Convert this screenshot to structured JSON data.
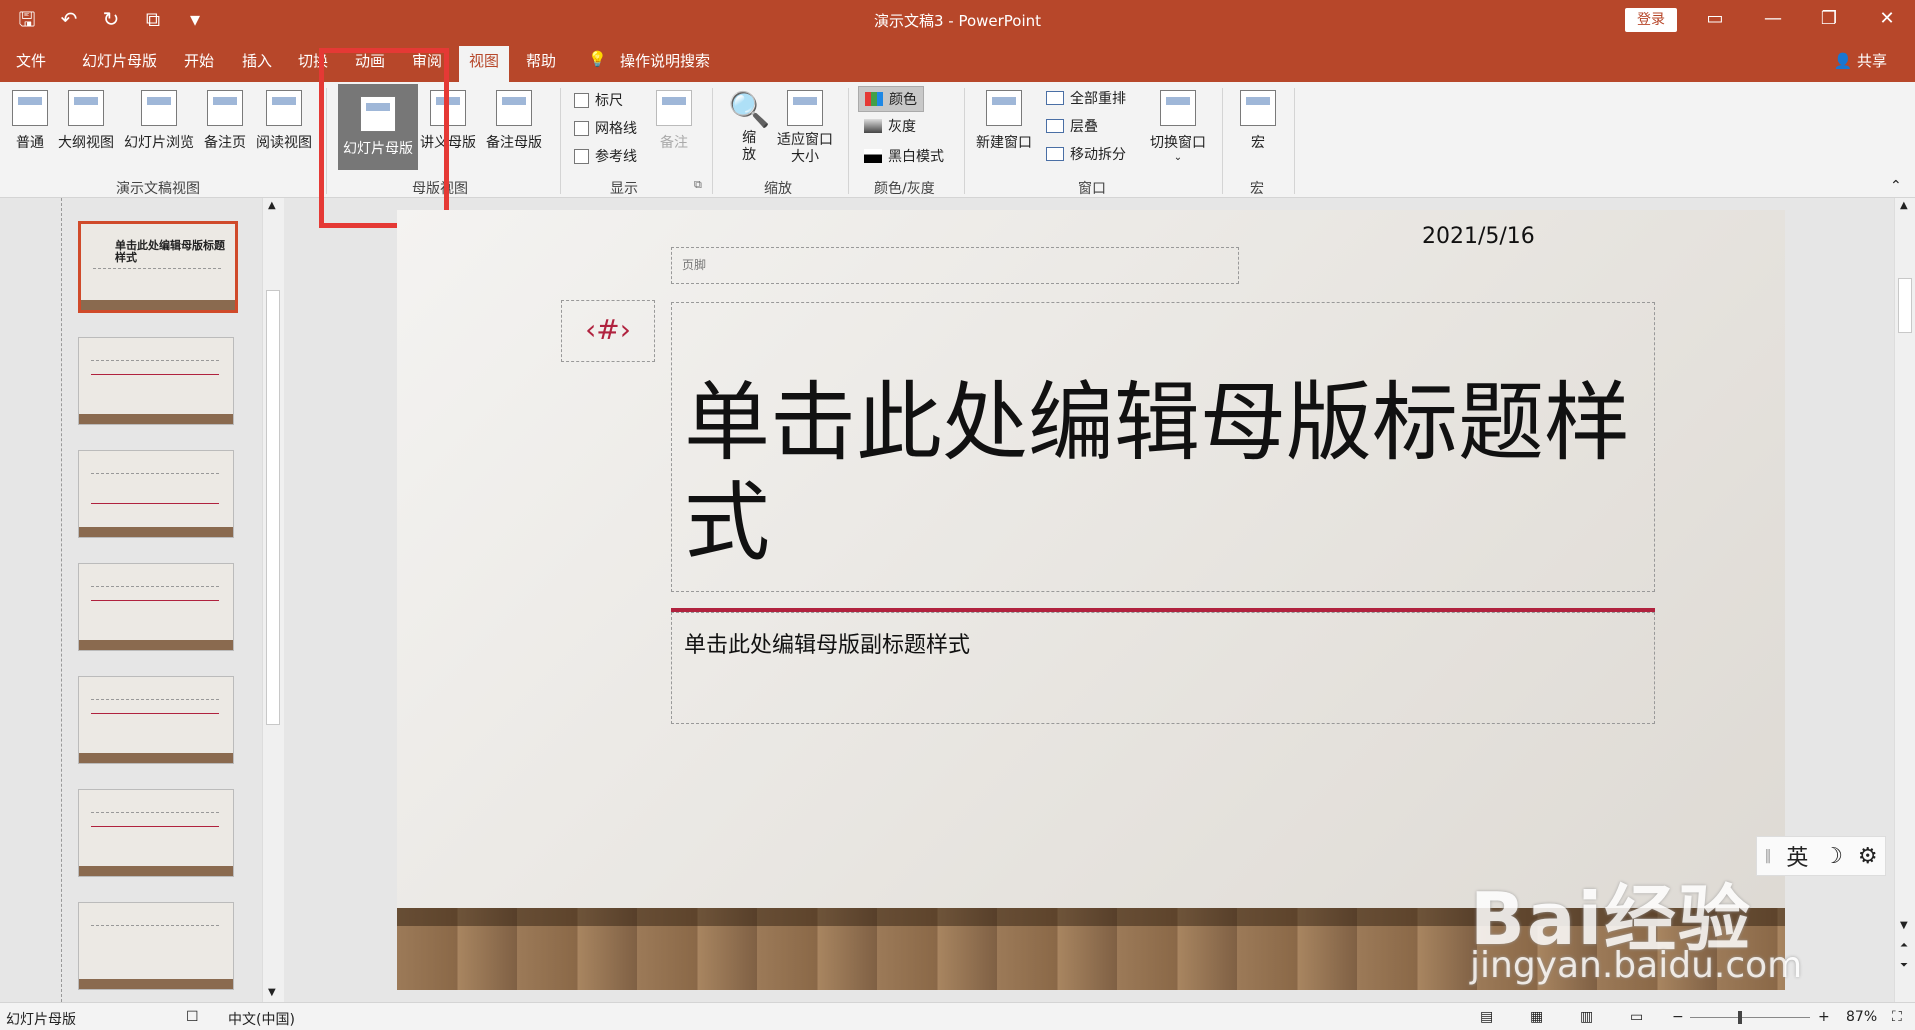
{
  "window": {
    "title": "演示文稿3 - PowerPoint",
    "login": "登录",
    "min": "—",
    "restore": "❐",
    "close": "✕"
  },
  "qat": {
    "save": "🖫",
    "undo": "↶",
    "redo": "↻",
    "present": "⧉",
    "more": "▾"
  },
  "tabs": {
    "file": "文件",
    "slide_master": "幻灯片母版",
    "home": "开始",
    "insert": "插入",
    "transitions": "切换",
    "animations": "动画",
    "review": "审阅",
    "view": "视图",
    "help": "帮助",
    "tell_me": "操作说明搜索",
    "share": "共享"
  },
  "ribbon": {
    "presentation_views": {
      "label": "演示文稿视图",
      "normal": "普通",
      "outline": "大纲视图",
      "sorter": "幻灯片浏览",
      "notes_page": "备注页",
      "reading": "阅读视图"
    },
    "master_views": {
      "label": "母版视图",
      "slide_master": "幻灯片母版",
      "handout_master": "讲义母版",
      "notes_master": "备注母版"
    },
    "show": {
      "label": "显示",
      "ruler": "标尺",
      "gridlines": "网格线",
      "guides": "参考线",
      "notes": "备注"
    },
    "zoom": {
      "label": "缩放",
      "zoom": "缩放",
      "fit": "适应窗口大小"
    },
    "color": {
      "label": "颜色/灰度",
      "color": "颜色",
      "grayscale": "灰度",
      "bw": "黑白模式"
    },
    "window": {
      "label": "窗口",
      "new_window": "新建窗口",
      "arrange_all": "全部重排",
      "cascade": "层叠",
      "move_split": "移动拆分",
      "switch": "切换窗口"
    },
    "macros": {
      "label": "宏",
      "macros": "宏"
    }
  },
  "slide": {
    "footer": "页脚",
    "date": "2021/5/16",
    "number": "‹#›",
    "title": "单击此处编辑母版标题样式",
    "subtitle": "单击此处编辑母版副标题样式"
  },
  "thumbnail": {
    "title": "单击此处编辑母版标题样式"
  },
  "ime": {
    "lang": "英",
    "moon": "☽",
    "gear": "⚙"
  },
  "watermark": {
    "brand": "Bai经验",
    "url": "jingyan.baidu.com"
  },
  "status": {
    "mode": "幻灯片母版",
    "language": "中文(中国)",
    "zoom": "87%",
    "zoom_level": 0.87
  },
  "colors": {
    "accent": "#b7472a",
    "title_red": "#b0223e"
  }
}
